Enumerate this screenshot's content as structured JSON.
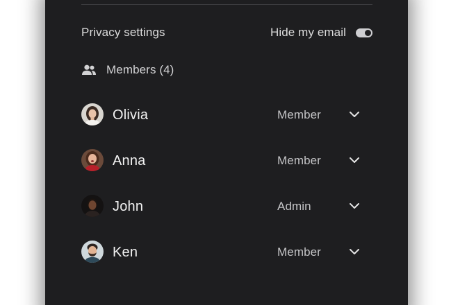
{
  "privacy": {
    "label": "Privacy settings",
    "hide_email_label": "Hide my email",
    "hide_email_enabled": true
  },
  "members": {
    "header_icon": "people-icon",
    "label": "Members (4)",
    "list": [
      {
        "name": "Olivia",
        "role": "Member",
        "avatar_icon": "avatar-photo"
      },
      {
        "name": "Anna",
        "role": "Member",
        "avatar_icon": "avatar-photo"
      },
      {
        "name": "John",
        "role": "Admin",
        "avatar_icon": "avatar-photo"
      },
      {
        "name": "Ken",
        "role": "Member",
        "avatar_icon": "avatar-photo"
      }
    ]
  },
  "colors": {
    "panel_background": "#1e1e20",
    "primary_text": "#f2f2f2",
    "secondary_text": "#c4c4c6",
    "toggle_track": "#cfcfd2"
  }
}
